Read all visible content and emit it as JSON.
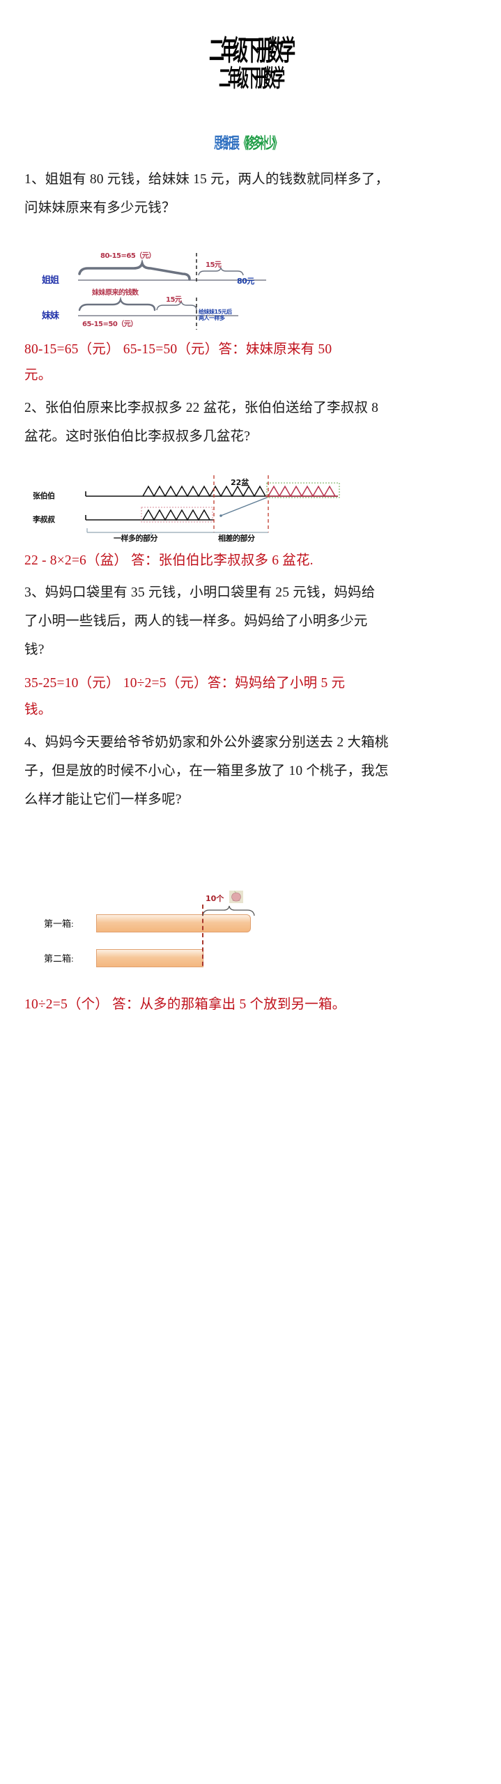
{
  "document": {
    "title_line1": "二年级下册数学",
    "title_line2": "二年级下册数学",
    "subtitle_blue": "思维拓展",
    "subtitle_green": "《移多补少》"
  },
  "problems": [
    {
      "id": "q1",
      "line1": "1、姐姐有 80 元钱，给妹妹 15 元，两人的钱数就同样多了，",
      "line2": "问妹妹原来有多少元钱？",
      "answer_line1": "80-15=65（元）      65-15=50（元）答：妹妹原来有 50",
      "answer_line2": "元。"
    },
    {
      "id": "q2",
      "line1": "2、张伯伯原来比李叔叔多 22 盆花，张伯伯送给了李叔叔 8",
      "line2": "盆花。这时张伯伯比李叔叔多几盆花?",
      "answer_line1": "22 - 8×2=6（盆）   答：张伯伯比李叔叔多 6 盆花."
    },
    {
      "id": "q3",
      "line1": "3、妈妈口袋里有 35 元钱，小明口袋里有 25 元钱，妈妈给",
      "line2": "了小明一些钱后，两人的钱一样多。妈妈给了小明多少元",
      "line3": "钱?",
      "answer_line1": "35-25=10（元）  10÷2=5（元）答：妈妈给了小明 5 元",
      "answer_line2": "钱。"
    },
    {
      "id": "q4",
      "line1": "4、妈妈今天要给爷爷奶奶家和外公外婆家分别送去 2 大箱桃",
      "line2": "子，但是放的时候不小心，在一箱里多放了 10 个桃子，我怎",
      "line3": "么样才能让它们一样多呢?",
      "answer_line1": "10÷2=5（个）  答：从多的那箱拿出 5 个放到另一箱。"
    }
  ],
  "diagram1": {
    "name": "sister-money-bar-diagram",
    "row1_label": "姐姐",
    "row2_label": "妹妹",
    "top_bracket_text": "80-15=65（元）",
    "right_bracket_text": "15元",
    "total_text": "80元",
    "row2_bracket_text": "妹妹原来的钱数",
    "row2_right_text": "15元",
    "row2_bottom_text": "65-15=50（元）",
    "note_line1": "给妹妹15元后",
    "note_line2": "两人一样多"
  },
  "diagram2": {
    "name": "flowerpot-comparison-diagram",
    "row1_label": "张伯伯",
    "row2_label": "李叔叔",
    "top_text": "22盆",
    "caption_left": "一样多的部分",
    "caption_right": "相差的部分"
  },
  "diagram3": {
    "name": "peach-box-diagram",
    "box1_label": "第一箱:",
    "box2_label": "第二箱:",
    "extra_count": "10个",
    "peach_icon": "peach-icon"
  },
  "colors": {
    "answer_red": "#c0111b",
    "diagram_blue": "#2233aa",
    "diagram_red": "#b2334a",
    "subtitle_blue": "#2e6fc0",
    "subtitle_green": "#1f9d46",
    "bar_orange": "#f4b77f",
    "dash_red": "#a8352a"
  }
}
